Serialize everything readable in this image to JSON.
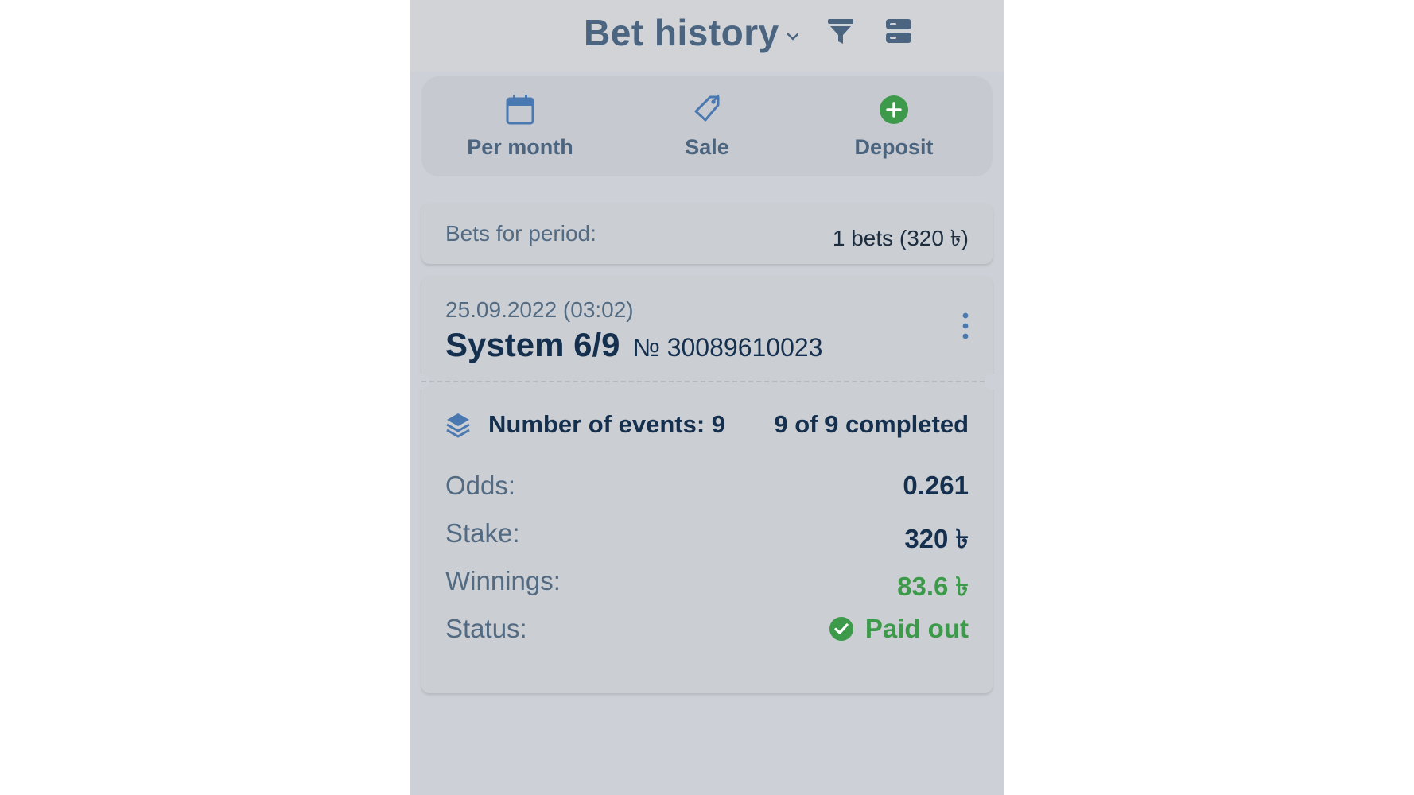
{
  "header": {
    "title": "Bet history",
    "icons": [
      "chevron-down-icon",
      "filter-icon",
      "list-view-icon"
    ]
  },
  "toolbar": {
    "items": [
      {
        "label": "Per month",
        "icon": "calendar-icon"
      },
      {
        "label": "Sale",
        "icon": "tag-icon"
      },
      {
        "label": "Deposit",
        "icon": "plus-circle-icon"
      }
    ]
  },
  "summary": {
    "label": "Bets for period:",
    "value": "1 bets (320 ৳)"
  },
  "bet": {
    "date": "25.09.2022 (03:02)",
    "type": "System 6/9",
    "number": "№ 30089610023",
    "events_label": "Number of events: 9",
    "events_progress": "9 of 9 completed",
    "odds_label": "Odds:",
    "odds_value": "0.261",
    "stake_label": "Stake:",
    "stake_value": "320 ৳",
    "winnings_label": "Winnings:",
    "winnings_value": "83.6 ৳",
    "status_label": "Status:",
    "status_value": "Paid out"
  },
  "colors": {
    "primary_text": "#14304e",
    "muted_text": "#526a82",
    "success": "#3d9a4a",
    "accent_blue": "#4a78b0"
  }
}
